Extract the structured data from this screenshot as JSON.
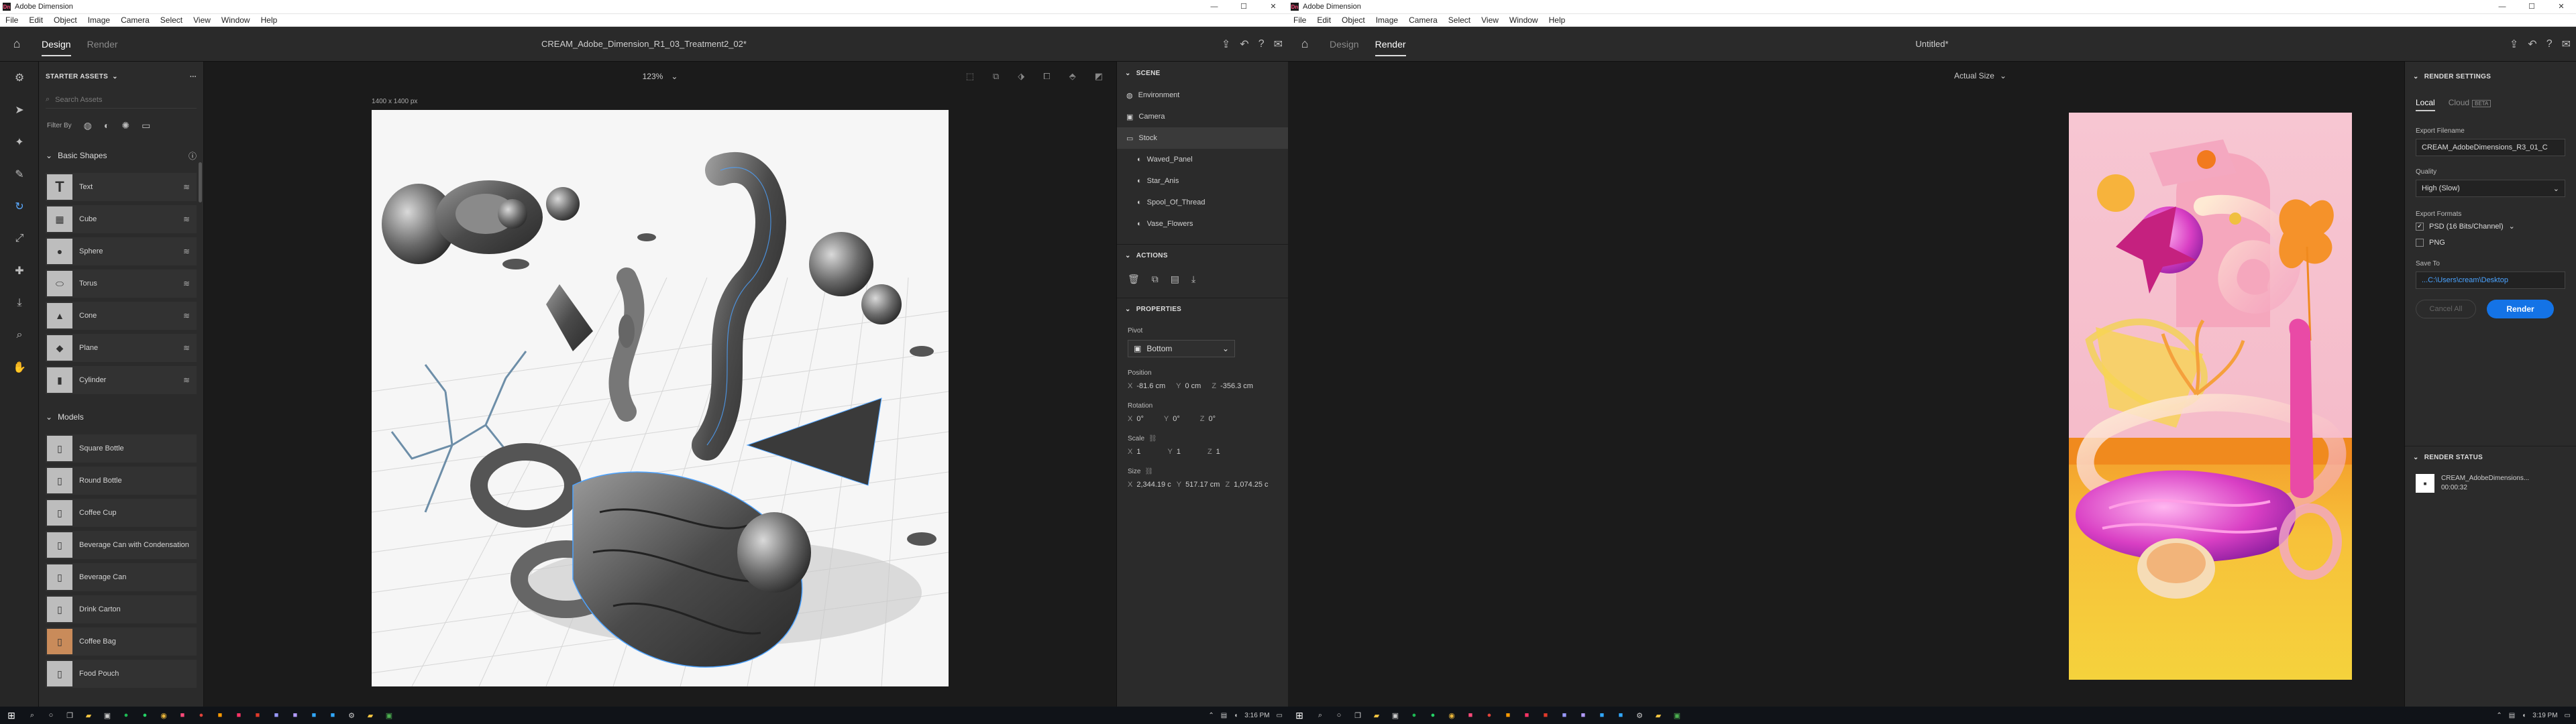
{
  "left": {
    "window_title": "Adobe Dimension",
    "menu": [
      "File",
      "Edit",
      "Object",
      "Image",
      "Camera",
      "Select",
      "View",
      "Window",
      "Help"
    ],
    "tabs": {
      "design": "Design",
      "render": "Render"
    },
    "doc_title": "CREAM_Adobe_Dimension_R1_03_Treatment2_02*",
    "assets": {
      "header": "STARTER ASSETS",
      "search_placeholder": "Search Assets",
      "filter_label": "Filter By",
      "basic_shapes_title": "Basic Shapes",
      "basic_shapes": [
        "Text",
        "Cube",
        "Sphere",
        "Torus",
        "Cone",
        "Plane",
        "Cylinder"
      ],
      "models_title": "Models",
      "models": [
        "Square Bottle",
        "Round Bottle",
        "Coffee Cup",
        "Beverage Can with Condensation",
        "Beverage Can",
        "Drink Carton",
        "Coffee Bag",
        "Food Pouch"
      ]
    },
    "canvas": {
      "zoom": "123%",
      "dims": "1400 x 1400 px"
    },
    "scene": {
      "header": "SCENE",
      "items": [
        "Environment",
        "Camera",
        "Stock"
      ],
      "children": [
        "Waved_Panel",
        "Star_Anis",
        "Spool_Of_Thread",
        "Vase_Flowers"
      ]
    },
    "actions_header": "ACTIONS",
    "properties": {
      "header": "PROPERTIES",
      "pivot_label": "Pivot",
      "pivot_value": "Bottom",
      "position_label": "Position",
      "position": {
        "x": "-81.6 cm",
        "y": "0 cm",
        "z": "-356.3 cm"
      },
      "rotation_label": "Rotation",
      "rotation": {
        "x": "0°",
        "y": "0°",
        "z": "0°"
      },
      "scale_label": "Scale",
      "scale": {
        "x": "1",
        "y": "1",
        "z": "1"
      },
      "size_label": "Size",
      "size": {
        "x": "2,344.19 c",
        "y": "517.17 cm",
        "z": "1,074.25 c"
      },
      "link_icon": "link-icon"
    },
    "axes": {
      "x": "X",
      "y": "Y",
      "z": "Z"
    },
    "clock": "3:16 PM"
  },
  "right": {
    "window_title": "Adobe Dimension",
    "menu": [
      "File",
      "Edit",
      "Object",
      "Image",
      "Camera",
      "Select",
      "View",
      "Window",
      "Help"
    ],
    "tabs": {
      "design": "Design",
      "render": "Render"
    },
    "doc_title": "Untitled*",
    "view_size": "Actual Size",
    "settings": {
      "header": "RENDER SETTINGS",
      "tab_local": "Local",
      "tab_cloud": "Cloud",
      "beta": "BETA",
      "filename_label": "Export Filename",
      "filename": "CREAM_AdobeDimensions_R3_01_C",
      "quality_label": "Quality",
      "quality": "High (Slow)",
      "formats_label": "Export Formats",
      "format_psd": "PSD (16 Bits/Channel)",
      "format_png": "PNG",
      "saveto_label": "Save To",
      "saveto": "...C:\\Users\\cream\\Desktop",
      "cancel": "Cancel All",
      "render": "Render"
    },
    "status": {
      "header": "RENDER STATUS",
      "name": "CREAM_AdobeDimensions...",
      "time": "00:00:32"
    },
    "clock": "3:19 PM"
  },
  "colors": {
    "accent": "#1473e6",
    "bg": "#1e1e1e",
    "panel": "#2b2b2b",
    "selection_outline": "#4da3ff"
  }
}
